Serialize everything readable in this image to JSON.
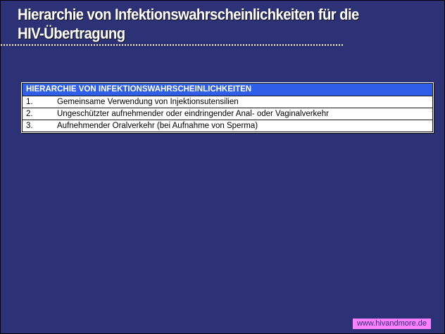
{
  "title": {
    "line1": "Hierarchie von Infektionswahrscheinlichkeiten für die",
    "line2": "HIV-Übertragung"
  },
  "table": {
    "header": "HIERARCHIE VON INFEKTIONSWAHRSCHEINLICHKEITEN",
    "rows": [
      {
        "num": "1.",
        "text": "Gemeinsame Verwendung von Injektionsutensilien"
      },
      {
        "num": "2.",
        "text": "Ungeschützter aufnehmender oder eindringender Anal- oder Vaginalverkehr"
      },
      {
        "num": "3.",
        "text": "Aufnehmender Oralverkehr (bei Aufnahme von Sperma)"
      }
    ]
  },
  "footer": {
    "link": "www.hivandmore.de"
  },
  "colors": {
    "background": "#2d3175",
    "header_blue": "#2f5fe8",
    "footer_pink": "#ff7fff"
  }
}
